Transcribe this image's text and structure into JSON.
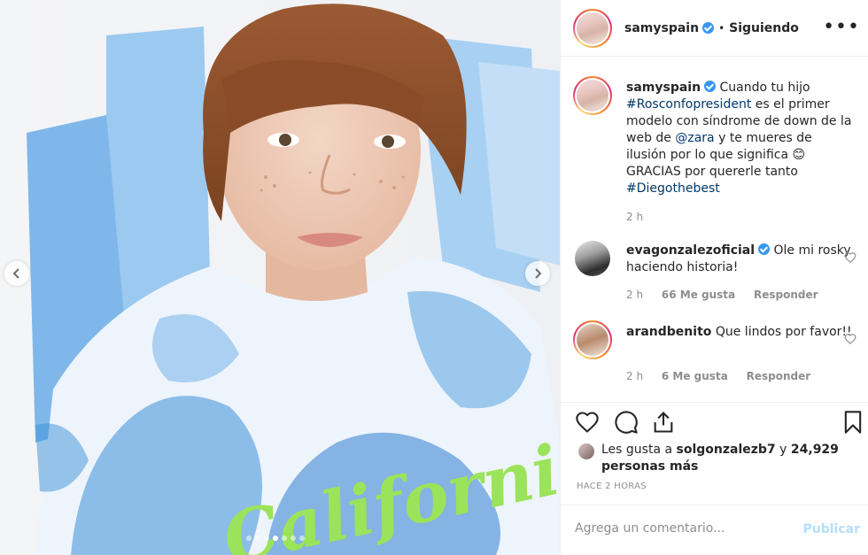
{
  "post": {
    "username": "samyspain",
    "separator": "•",
    "follow_state": "Siguiendo",
    "more_icon": "more-options-icon"
  },
  "caption": {
    "username": "samyspain",
    "part1": "Cuando tu hijo",
    "hashtag1": "#Rosconfopresident",
    "part2": "es el primer modelo con síndrome de down de la web de",
    "mention": "@zara",
    "part3": "y te mueres de ilusión por lo que significa",
    "emoji": "😊",
    "part4": "GRACIAS por quererle tanto",
    "hashtag2": "#Diegothebest",
    "time": "2 h"
  },
  "comments": [
    {
      "username": "evagonzalezoficial",
      "verified": true,
      "text": "Ole mi rosky haciendo historia!",
      "time": "2 h",
      "likes": "66 Me gusta",
      "reply": "Responder"
    },
    {
      "username": "arandbenito",
      "verified": false,
      "text": "Que lindos por favor!!",
      "time": "2 h",
      "likes": "6 Me gusta",
      "reply": "Responder"
    }
  ],
  "likes": {
    "prefix": "Les gusta a",
    "user": "solgonzalezb7",
    "conj": "y",
    "count": "24,929 personas más"
  },
  "time_ago": "HACE 2 HORAS",
  "add_comment": {
    "placeholder": "Agrega un comentario...",
    "publish": "Publicar"
  },
  "carousel": {
    "slide_count": 7,
    "active_slide": 3
  },
  "photo_text": "California",
  "colors": {
    "link": "#00376b",
    "verified": "#3897f0",
    "muted": "#8e8e8e",
    "publish_disabled": "#b2dffc"
  }
}
